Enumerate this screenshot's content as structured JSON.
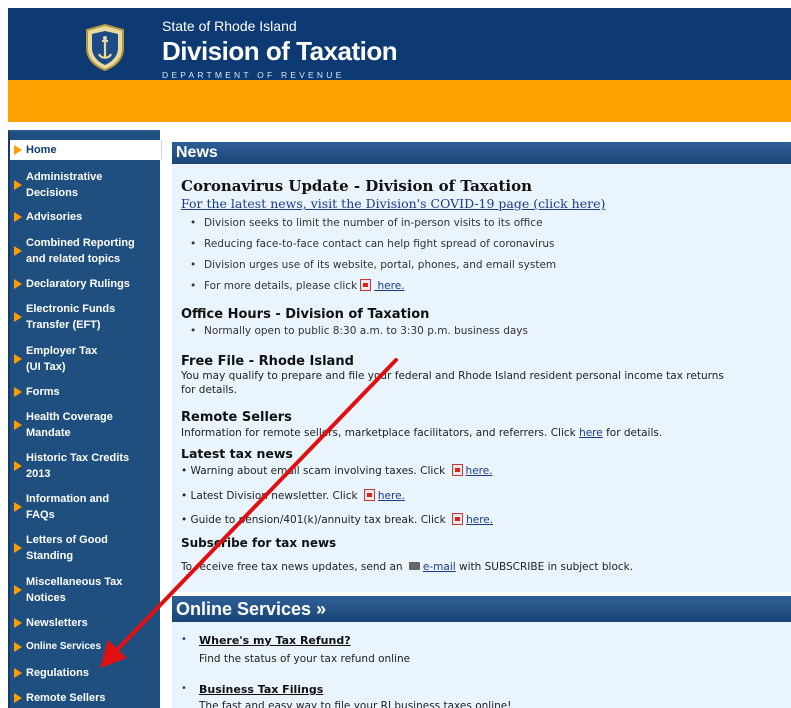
{
  "header": {
    "state": "State of Rhode Island",
    "division": "Division of Taxation",
    "department": "DEPARTMENT OF REVENUE"
  },
  "sidebar": {
    "items": [
      {
        "label": "Home",
        "active": true
      },
      {
        "label": "Administrative\nDecisions"
      },
      {
        "label": "Advisories"
      },
      {
        "label": "Combined Reporting\nand related topics"
      },
      {
        "label": "Declaratory Rulings"
      },
      {
        "label": "Electronic Funds\nTransfer (EFT)"
      },
      {
        "label": "Employer Tax\n(UI Tax)"
      },
      {
        "label": "Forms"
      },
      {
        "label": "Health Coverage\nMandate"
      },
      {
        "label": "Historic Tax Credits\n2013"
      },
      {
        "label": "Information and\nFAQs"
      },
      {
        "label": "Letters of Good\nStanding"
      },
      {
        "label": "Miscellaneous Tax\nNotices"
      },
      {
        "label": "Newsletters"
      },
      {
        "label": "Online Services"
      },
      {
        "label": "Regulations"
      },
      {
        "label": "Remote Sellers"
      }
    ]
  },
  "news": {
    "header": "News",
    "covid": {
      "title": "Coronavirus Update - Division of Taxation",
      "link": "For the latest news, visit the Division's COVID-19 page (click here)",
      "bullets": [
        "Division seeks to limit the number of in-person visits to its office",
        "Reducing face-to-face contact can help fight spread of coronavirus",
        "Division urges use of its website, portal, phones, and email system"
      ],
      "details_prefix": "For more details, please click",
      "details_link": " here."
    },
    "office_hours": {
      "title": "Office Hours - Division of Taxation",
      "bullet": "Normally open to public 8:30 a.m. to 3:30 p.m. business days"
    },
    "free_file": {
      "title": "Free File - Rhode Island",
      "line1": "You may qualify to prepare and file your federal and Rhode Island resident personal income tax returns",
      "line2": "for details."
    },
    "remote_sellers": {
      "title": "Remote Sellers",
      "text": "Information for remote sellers, marketplace facilitators, and referrers. Click",
      "link": "here",
      "suffix": "for details."
    },
    "latest": {
      "title": "Latest tax news",
      "items": [
        {
          "text": "• Warning about email scam involving taxes. Click",
          "link": "here."
        },
        {
          "text": "• Latest Division newsletter. Click",
          "link": "here."
        },
        {
          "text": "• Guide to pension/401(k)/annuity tax break. Click",
          "link": "here."
        }
      ]
    },
    "subscribe": {
      "title": "Subscribe for tax news",
      "prefix": "To receive free tax news updates, send an",
      "link": "e-mail",
      "suffix": "with SUBSCRIBE in subject block."
    }
  },
  "online_services": {
    "header": "Online Services »",
    "items": [
      {
        "title": "Where's my Tax Refund?",
        "desc": "Find the status of your tax refund online"
      },
      {
        "title": "Business Tax Filings",
        "desc": "The fast and easy way to file your RI business taxes online!"
      }
    ]
  },
  "colors": {
    "header_blue": "#0d3a72",
    "orange": "#ffa100",
    "sidebar_blue": "#1f4f7f",
    "annotation_arrow": "#e01010"
  }
}
